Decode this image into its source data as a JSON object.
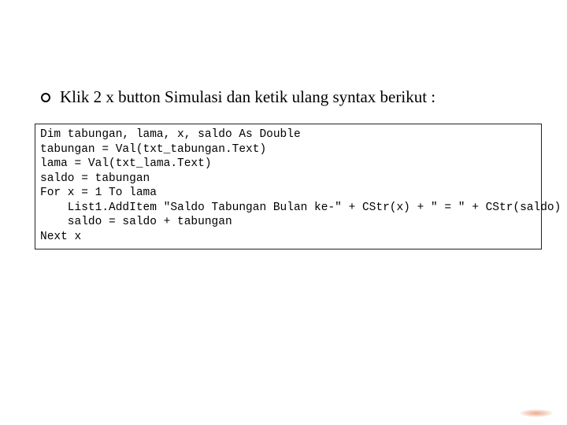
{
  "bullet": {
    "text": "Klik 2 x button Simulasi dan ketik ulang syntax berikut :"
  },
  "code": {
    "lines": [
      "Dim tabungan, lama, x, saldo As Double",
      "tabungan = Val(txt_tabungan.Text)",
      "lama = Val(txt_lama.Text)",
      "saldo = tabungan",
      "For x = 1 To lama",
      "    List1.AddItem \"Saldo Tabungan Bulan ke-\" + CStr(x) + \" = \" + CStr(saldo)",
      "    saldo = saldo + tabungan",
      "Next x"
    ]
  }
}
